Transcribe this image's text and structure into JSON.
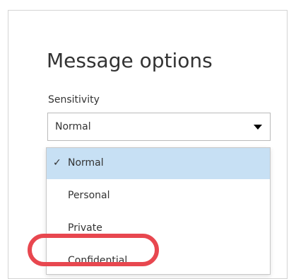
{
  "dialog": {
    "title": "Message options",
    "sensitivity": {
      "label": "Sensitivity",
      "value": "Normal",
      "options": [
        {
          "label": "Normal",
          "selected": true,
          "check": "✓"
        },
        {
          "label": "Personal",
          "selected": false
        },
        {
          "label": "Private",
          "selected": false
        },
        {
          "label": "Confidential",
          "selected": false,
          "highlighted": true
        }
      ]
    }
  },
  "colors": {
    "selected_option_bg": "#c7e0f4",
    "highlight_ring": "#e8474f",
    "text": "#333333"
  },
  "icons": {
    "select_caret": "caret-down-icon",
    "selected_check": "checkmark-icon"
  }
}
